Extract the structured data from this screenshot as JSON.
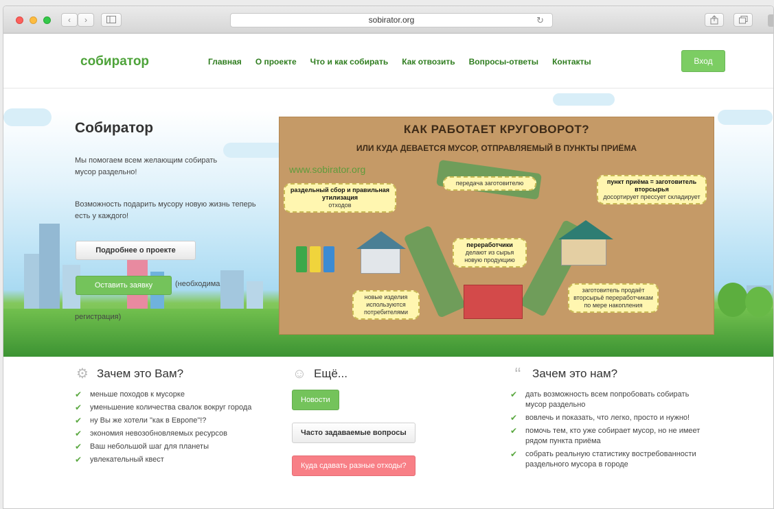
{
  "browser": {
    "address": "sobirator.org",
    "reload_glyph": "↻",
    "back_glyph": "‹",
    "forward_glyph": "›"
  },
  "header": {
    "logo": "собиратор",
    "menu": [
      "Главная",
      "О проекте",
      "Что и как собирать",
      "Как отвозить",
      "Вопросы-ответы",
      "Контакты"
    ],
    "login": "Вход"
  },
  "hero": {
    "title": "Собиратор",
    "text1": "Мы помогаем всем желающим собирать мусор раздельно!",
    "text2": "Возможность подарить мусору новую жизнь теперь есть у каждого!",
    "more_button": "Подробнее о проекте",
    "apply_button": "Оставить заявку",
    "apply_note_1": "(необходима",
    "apply_note_2": "регистрация)"
  },
  "infographic": {
    "title": "КАК РАБОТАЕТ КРУГОВОРОТ?",
    "subtitle": "ИЛИ КУДА ДЕВАЕТСЯ МУСОР, ОТПРАВЛЯЕМЫЙ В ПУНКТЫ ПРИЁМА",
    "url": "www.sobirator.org",
    "bubble_separate_title": "раздельный сбор и правильная утилизация",
    "bubble_separate_sub": "отходов",
    "bubble_transfer": "передача заготовителю",
    "bubble_point_title": "пункт приёма = заготовитель вторсырья",
    "bubble_point_sub": "досортирует прессует складирует",
    "bubble_processors_title": "переработчики",
    "bubble_processors_sub": "делают из сырья новую продукцию",
    "bubble_new_items": "новые изделия используются потребителями",
    "bubble_collector": "заготовитель продаёт вторсырьё переработчикам по мере накопления"
  },
  "features": {
    "why_you": {
      "icon": "gear-icon",
      "title": "Зачем это Вам?",
      "items": [
        "меньше походов к мусорке",
        "уменьшение количества свалок вокруг города",
        "ну Вы же хотели \"как в Европе\"!?",
        "экономия невозобновляемых ресурсов",
        "Ваш небольшой шаг для планеты",
        "увлекательный квест"
      ]
    },
    "more": {
      "icon": "user-icon",
      "title": "Ещё...",
      "news": "Новости",
      "faq": "Часто задаваемые вопросы",
      "where": "Куда сдавать разные отходы?"
    },
    "why_us": {
      "icon": "quote-icon",
      "title": "Зачем это нам?",
      "items": [
        "дать возможность всем попробовать собирать мусор раздельно",
        "вовлечь и показать, что легко, просто и нужно!",
        "помочь тем, кто уже собирает мусор, но не имеет рядом пункта приёма",
        "собрать реальную статистику востребованности раздельного мусора в городе"
      ]
    }
  }
}
